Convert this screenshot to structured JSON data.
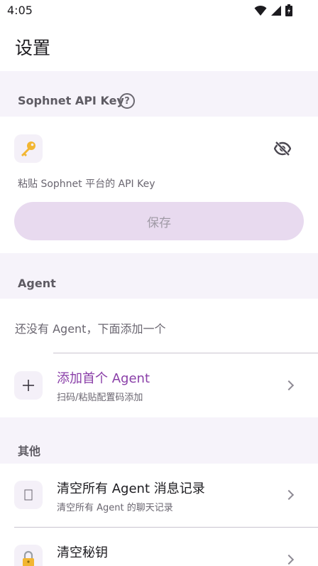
{
  "status_bar": {
    "time": "4:05"
  },
  "app_bar": {
    "title": "设置"
  },
  "api_key_section": {
    "header": "Sophnet API Key",
    "help_glyph": "?",
    "hint": "粘贴 Sophnet 平台的 API Key",
    "save_label": "保存"
  },
  "agent_section": {
    "header": "Agent",
    "empty_text": "还没有 Agent，下面添加一个",
    "add_title": "添加首个 Agent",
    "add_subtitle": "扫码/粘贴配置码添加"
  },
  "other_section": {
    "header": "其他",
    "items": [
      {
        "title": "清空所有 Agent 消息记录",
        "subtitle": "清空所有 Agent 的聊天记录"
      },
      {
        "title": "清空秘钥",
        "subtitle": ""
      }
    ]
  },
  "colors": {
    "accent": "#8a3fa8",
    "section_bg": "#f6f3fa",
    "save_button_bg": "#e8daef"
  },
  "icons": [
    "wifi-icon",
    "cellular-icon",
    "battery-icon",
    "help-icon",
    "key-icon",
    "visibility-off-icon",
    "plus-icon",
    "chevron-right-icon",
    "clear-messages-icon",
    "lock-icon"
  ]
}
